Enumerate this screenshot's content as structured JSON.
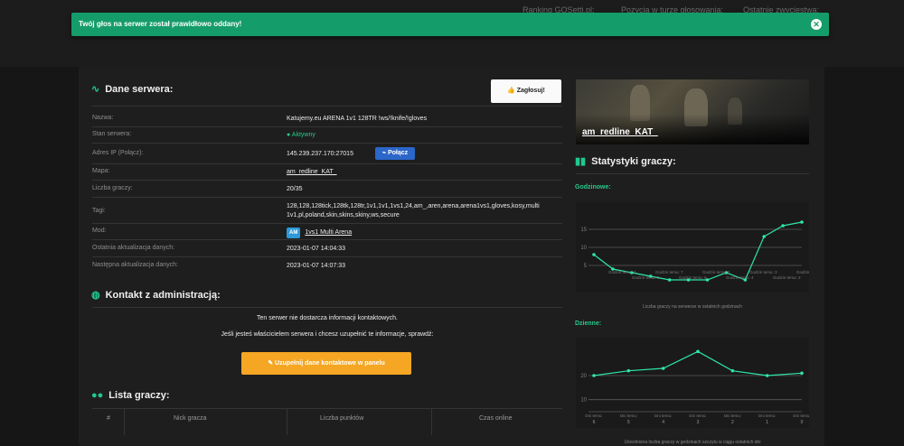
{
  "header_ghost": {
    "ranking": "Ranking GOSetti.pl:",
    "position": "Pozycja w turze głosowania:",
    "recent": "Ostatnie zwycięstwa:"
  },
  "toast": {
    "message": "Twój głos na serwer został prawidłowo oddany!",
    "close": "✕"
  },
  "server": {
    "title": "Dane serwera:",
    "vote_label": "Zagłosuj!",
    "rows": [
      {
        "label": "Nazwa:",
        "value": "Katujemy.eu ARENA 1v1 128TR !ws/!knife/!gloves"
      },
      {
        "label": "Stan serwera:",
        "value": "Aktywny"
      },
      {
        "label": "Adres IP (Połącz):",
        "value": "145.239.237.170:27015"
      },
      {
        "label": "Mapa:",
        "value": "am_redline_KAT_"
      },
      {
        "label": "Liczba graczy:",
        "value": "20/35"
      },
      {
        "label": "Tagi:",
        "value": "128,128,128tick,128tk,128tr,1v1,1v1,1vs1,24,am_,aren,arena,arena1vs1,gloves,kosy,multi 1v1,pl,poland,skin,skins,skiny,ws,secure"
      },
      {
        "label": "Mod:",
        "value": "1vs1 Multi Arena"
      },
      {
        "label": "Ostatnia aktualizacja danych:",
        "value": "2023-01-07 14:04:33"
      },
      {
        "label": "Następna aktualizacja danych:",
        "value": "2023-01-07 14:07:33"
      }
    ],
    "connect_label": "Połącz",
    "mod_badge": "AM"
  },
  "contact": {
    "title": "Kontakt z administracją:",
    "line1": "Ten serwer nie dostarcza informacji kontaktowych.",
    "line2": "Jeśli jesteś właścicielem serwera i chcesz uzupełnić te informacje, sprawdź:",
    "button": "Uzupełnij dane kontaktowe w panelu"
  },
  "players": {
    "title": "Lista graczy:",
    "columns": [
      "#",
      "Nick gracza",
      "Liczba punktów",
      "Czas online"
    ]
  },
  "map_banner": {
    "name": "am_redline_KAT_"
  },
  "stats": {
    "title": "Statystyki graczy:",
    "hourly_title": "Godzinowe:",
    "hourly_caption": "Liczba graczy na serwerze w ostatnich godzinach",
    "daily_title": "Dzienne:",
    "daily_caption": "Uśredniona liczba graczy w godzinach szczytu w ciągu ostatnich dni"
  },
  "chart_data": [
    {
      "type": "line",
      "title": "Godzinowe:",
      "caption": "Liczba graczy na serwerze w ostatnich godzinach",
      "y_ticks": [
        5,
        10,
        15
      ],
      "values": [
        8,
        4,
        3,
        2,
        1,
        1,
        1,
        3,
        1,
        13,
        16,
        17
      ],
      "x_labels": [
        "Godzin temu: 9",
        "Godzin temu: 7",
        "Godzin temu: 5",
        "Godzin temu: 3",
        "Godzin temu: 1"
      ],
      "x_labels_lower": [
        "Godzin temu: 8",
        "Godzin temu: 6",
        "Godzin temu: 4",
        "Godzin temu: 2"
      ],
      "ylim": [
        0,
        20
      ],
      "color": "#2ee6a6"
    },
    {
      "type": "line",
      "title": "Dzienne:",
      "caption": "Uśredniona liczba graczy w godzinach szczytu w ciągu ostatnich dni",
      "y_ticks": [
        10,
        20
      ],
      "categories": [
        "Dni temu: 6",
        "Dni temu: 5",
        "Dni temu: 4",
        "Dni temu: 3",
        "Dni temu: 2",
        "Dni temu: 1",
        "Dni temu: 0"
      ],
      "values": [
        20,
        22,
        23,
        30,
        22,
        20,
        21
      ],
      "ylim": [
        5,
        35
      ],
      "color": "#2ee6a6"
    }
  ]
}
